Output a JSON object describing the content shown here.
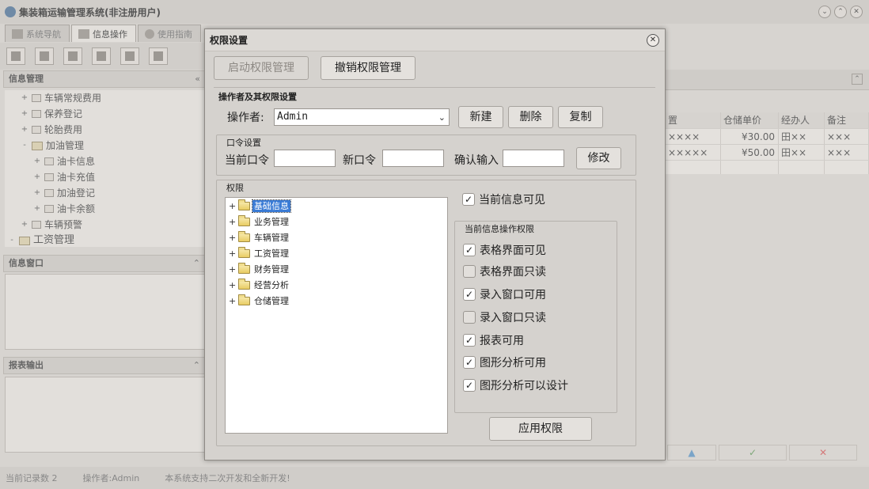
{
  "app": {
    "title": "集装箱运输管理系统(非注册用户)",
    "tabs": [
      {
        "label": "系统导航"
      },
      {
        "label": "信息操作"
      },
      {
        "label": "使用指南"
      }
    ],
    "panels": {
      "info_manage": "信息管理",
      "info_window": "信息窗口",
      "report_output": "报表输出"
    },
    "nav_tree": [
      {
        "label": "车辆常规费用"
      },
      {
        "label": "保养登记"
      },
      {
        "label": "轮胎费用"
      },
      {
        "label": "加油管理"
      },
      {
        "label": "油卡信息"
      },
      {
        "label": "油卡充值"
      },
      {
        "label": "加油登记"
      },
      {
        "label": "油卡余额"
      },
      {
        "label": "车辆预警"
      },
      {
        "label": "工资管理"
      }
    ],
    "grid": {
      "headers": [
        "置",
        "仓储单价",
        "经办人",
        "备注"
      ],
      "rows": [
        [
          "××××",
          "¥30.00",
          "田××",
          "×××"
        ],
        [
          "×××××",
          "¥50.00",
          "田××",
          "×××"
        ]
      ]
    },
    "statusbar": {
      "record_count": "当前记录数 2",
      "operator": "操作者:Admin",
      "note": "本系统支持二次开发和全新开发!"
    }
  },
  "dialog": {
    "title": "权限设置",
    "enable_button": "启动权限管理",
    "revoke_button": "撤销权限管理",
    "operator_section": "操作者及其权限设置",
    "operator_label": "操作者:",
    "operator_value": "Admin",
    "new_button": "新建",
    "delete_button": "删除",
    "copy_button": "复制",
    "password_section": "口令设置",
    "current_pwd_label": "当前口令",
    "new_pwd_label": "新口令",
    "confirm_pwd_label": "确认输入",
    "modify_button": "修改",
    "permissions_section": "权限",
    "perm_tree": [
      {
        "label": "基础信息",
        "selected": true
      },
      {
        "label": "业务管理",
        "selected": false
      },
      {
        "label": "车辆管理",
        "selected": false
      },
      {
        "label": "工资管理",
        "selected": false
      },
      {
        "label": "财务管理",
        "selected": false
      },
      {
        "label": "经营分析",
        "selected": false
      },
      {
        "label": "仓储管理",
        "selected": false
      }
    ],
    "visible_checkbox": {
      "label": "当前信息可见",
      "checked": true
    },
    "ops_group": "当前信息操作权限",
    "ops": [
      {
        "label": "表格界面可见",
        "checked": true
      },
      {
        "label": "表格界面只读",
        "checked": false
      },
      {
        "label": "录入窗口可用",
        "checked": true
      },
      {
        "label": "录入窗口只读",
        "checked": false
      },
      {
        "label": "报表可用",
        "checked": true
      },
      {
        "label": "图形分析可用",
        "checked": true
      },
      {
        "label": "图形分析可以设计",
        "checked": true
      }
    ],
    "apply_button": "应用权限"
  }
}
